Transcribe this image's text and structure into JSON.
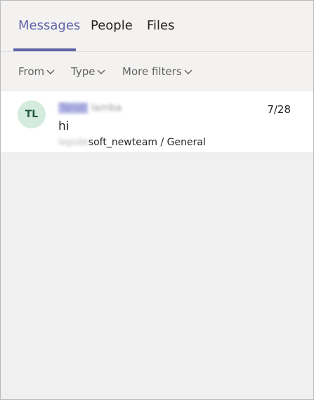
{
  "tabs": [
    {
      "label": "Messages",
      "active": true
    },
    {
      "label": "People",
      "active": false
    },
    {
      "label": "Files",
      "active": false
    }
  ],
  "filters": [
    {
      "label": "From"
    },
    {
      "label": "Type"
    },
    {
      "label": "More filters"
    }
  ],
  "result": {
    "avatar_initials": "TL",
    "sender_first": "Tarun",
    "sender_last": "lamba",
    "date": "7/28",
    "message": "hi",
    "location_redacted": "lepide",
    "location_visible": "soft_newteam / General"
  },
  "colors": {
    "accent": "#6264a7",
    "avatar_bg": "#d4ecdd",
    "avatar_text": "#21573a"
  }
}
